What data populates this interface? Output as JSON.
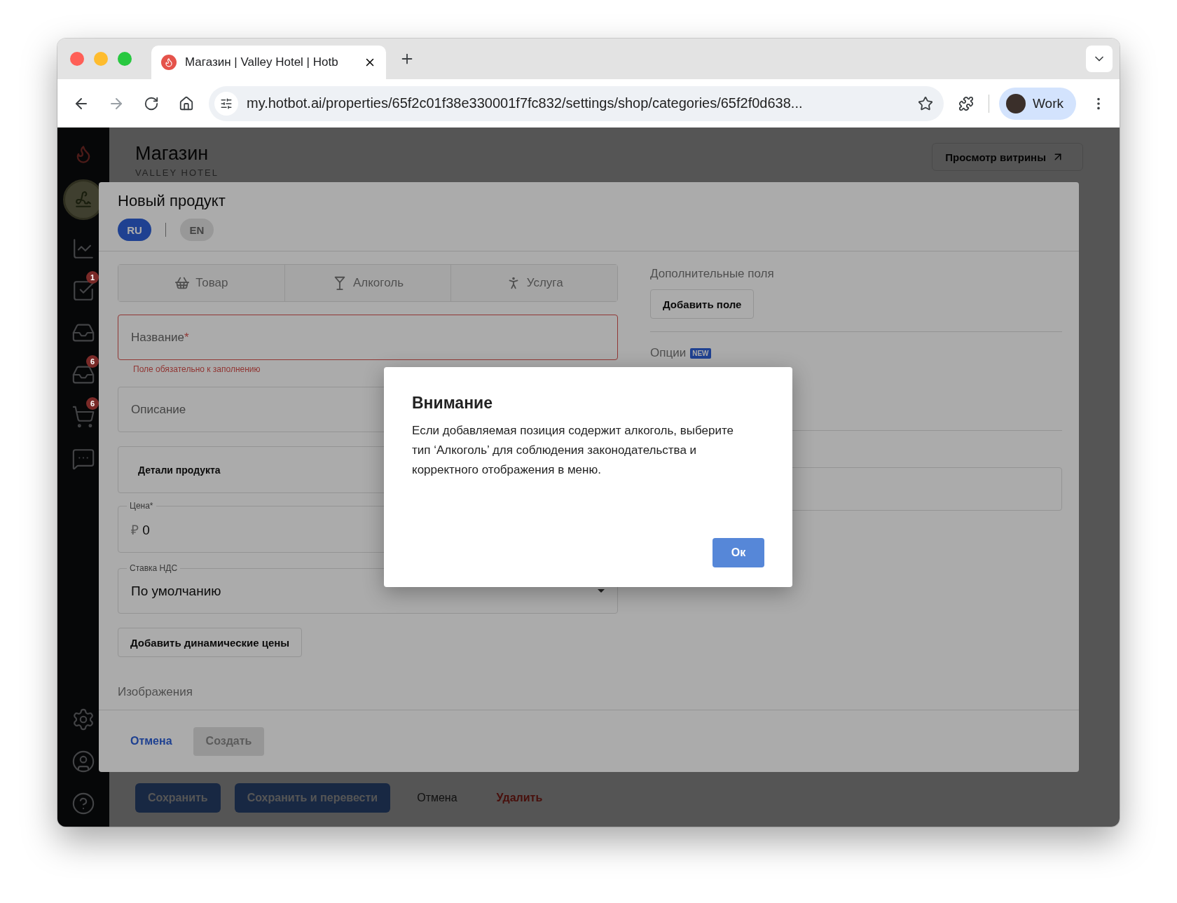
{
  "browser": {
    "tab_title": "Магазин | Valley Hotel | Hotb",
    "url": "my.hotbot.ai/properties/65f2c01f38e330001f7fc832/settings/shop/categories/65f2f0d638...",
    "profile": "Work"
  },
  "sidebar": {
    "badges": [
      "1",
      "6",
      "6"
    ]
  },
  "page": {
    "title": "Магазин",
    "subtitle": "VALLEY HOTEL",
    "storefront_button": "Просмотр витрины",
    "actions": [
      {
        "label": "Сохранить",
        "kind": "primary"
      },
      {
        "label": "Сохранить и перевести",
        "kind": "primary"
      },
      {
        "label": "Отмена",
        "kind": "text"
      },
      {
        "label": "Удалить",
        "kind": "danger"
      }
    ]
  },
  "product_modal": {
    "title": "Новый продукт",
    "languages": [
      {
        "label": "RU",
        "selected": true
      },
      {
        "label": "EN",
        "selected": false
      }
    ],
    "types": [
      {
        "kind": "goods",
        "label": "Товар",
        "selected": false
      },
      {
        "kind": "alcohol",
        "label": "Алкоголь",
        "selected": false
      },
      {
        "kind": "service",
        "label": "Услуга",
        "selected": false
      }
    ],
    "fields": [
      {
        "kind": "text",
        "label": "Название",
        "required_mark": "*",
        "error": "Поле обязательно к заполнению"
      },
      {
        "kind": "text",
        "label": "Описание"
      },
      {
        "kind": "section",
        "label": "Детали продукта"
      },
      {
        "kind": "price",
        "label": "Цена*",
        "currency": "₽",
        "value": "0"
      },
      {
        "kind": "select",
        "label": "Ставка НДС",
        "value": "По умолчанию"
      }
    ],
    "dynamic_prices_button": "Добавить динамические цены",
    "images_label": "Изображения",
    "extra_fields": {
      "label": "Дополнительные поля",
      "button": "Добавить поле"
    },
    "options": {
      "label": "Опции",
      "badge": "NEW"
    },
    "actions": [
      {
        "label": "Отмена",
        "kind": "link",
        "disabled": false
      },
      {
        "label": "Создать",
        "kind": "button",
        "disabled": true
      }
    ]
  },
  "alert": {
    "title": "Внимание",
    "message": "Если добавляемая позиция содержит алкоголь, выберите тип ‘Алкоголь’ для соблюдения законодательства и корректного отображения в меню.",
    "button": "Ок"
  }
}
